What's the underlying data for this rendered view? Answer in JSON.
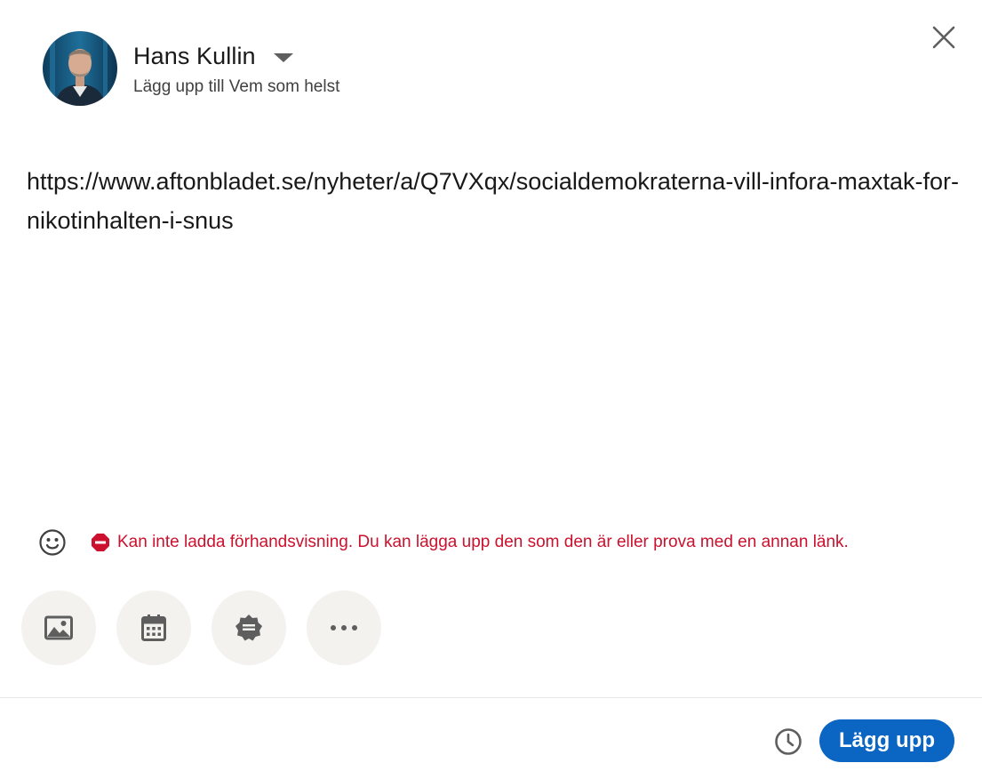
{
  "author": {
    "name": "Hans Kullin",
    "audience": "Lägg upp till Vem som helst",
    "avatar_icon": "profile-photo"
  },
  "post": {
    "text": "https://www.aftonbladet.se/nyheter/a/Q7VXqx/socialdemokraterna-vill-infora-maxtak-for-nikotinhalten-i-snus"
  },
  "status": {
    "error": "Kan inte ladda förhandsvisning. Du kan lägga upp den som den är eller prova med en annan länk.",
    "error_color": "#cb112d"
  },
  "tools": [
    {
      "icon": "image-icon",
      "label": "Lägg till media"
    },
    {
      "icon": "calendar-icon",
      "label": "Skapa ett evenemang"
    },
    {
      "icon": "badge-icon",
      "label": "Fira ett tillfälle"
    },
    {
      "icon": "more-icon",
      "label": "Mer"
    }
  ],
  "footer": {
    "schedule_icon": "clock-icon",
    "post_label": "Lägg upp",
    "post_color": "#0a66c2"
  }
}
